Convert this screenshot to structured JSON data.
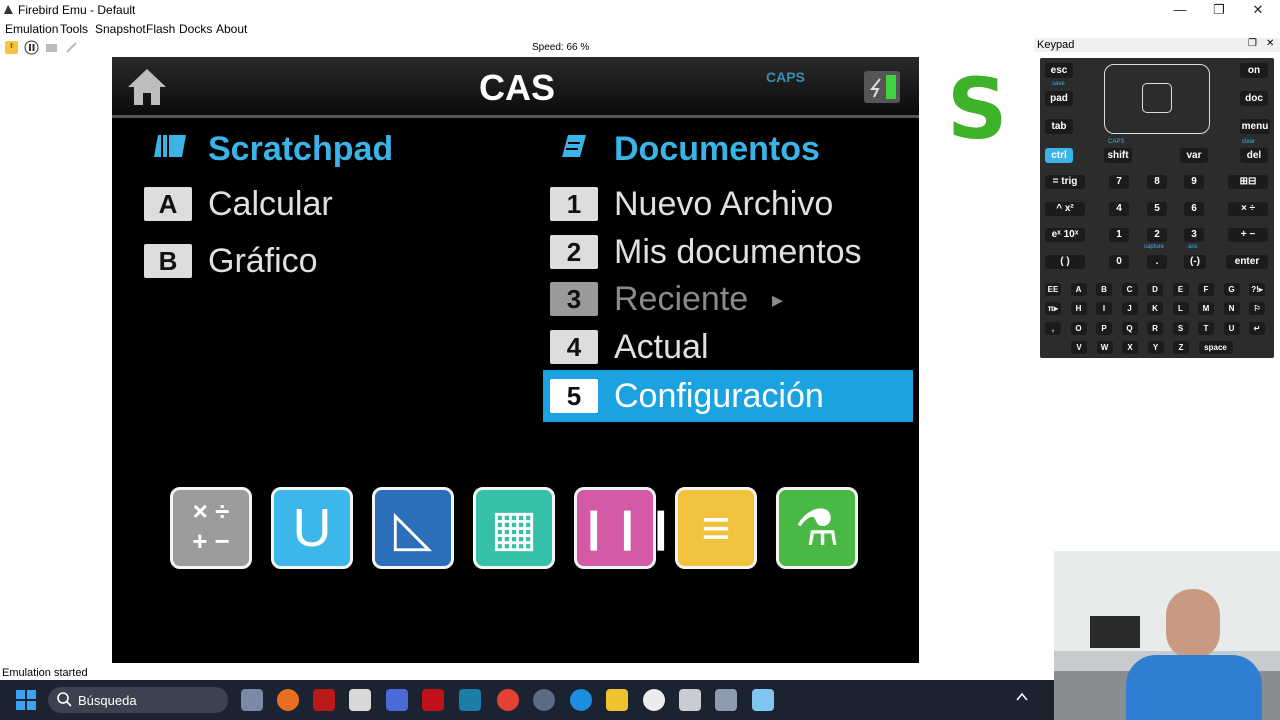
{
  "window": {
    "title": "Firebird Emu - Default",
    "minimize_glyph": "—",
    "maximize_glyph": "❐",
    "close_glyph": "✕"
  },
  "menu": [
    "Emulation",
    "Tools",
    "Snapshot",
    "Flash",
    "Docks",
    "About"
  ],
  "toolbar": {
    "speed": "Speed: 66 %"
  },
  "calc": {
    "header_title": "CAS",
    "caps": "CAPS",
    "scratchpad": {
      "title": "Scratchpad",
      "items": [
        {
          "key": "A",
          "label": "Calcular"
        },
        {
          "key": "B",
          "label": "Gráfico"
        }
      ]
    },
    "documents": {
      "title": "Documentos",
      "items": [
        {
          "key": "1",
          "label": "Nuevo Archivo"
        },
        {
          "key": "2",
          "label": "Mis documentos"
        },
        {
          "key": "3",
          "label": "Reciente"
        },
        {
          "key": "4",
          "label": "Actual"
        },
        {
          "key": "5",
          "label": "Configuración"
        }
      ]
    },
    "reciente_arrow": "▸",
    "apps": [
      "calculator-app-icon",
      "graphs-app-icon",
      "geometry-app-icon",
      "lists-spreadsheet-app-icon",
      "data-statistics-app-icon",
      "notes-app-icon",
      "vernier-dataquest-app-icon"
    ],
    "app_glyphs": {
      "calc": "× ÷\n+ −",
      "graph": "U",
      "geom": "◺",
      "lists": "▦",
      "data": "❙❙❙",
      "notes": "≡",
      "lab": "⚗"
    }
  },
  "sidebar_logo": "S",
  "keypad": {
    "title": "Keypad",
    "float_glyph": "❐",
    "close_glyph": "✕",
    "top": {
      "esc": "esc",
      "pad": "pad",
      "tab": "tab",
      "on": "on",
      "doc": "doc",
      "menu": "menu",
      "save": "save"
    },
    "row_ctrl": {
      "ctrl": "ctrl",
      "shift": "shift",
      "var": "var",
      "del": "del",
      "caps": "CAPS",
      "clear": "clear"
    },
    "num_rows": [
      [
        "= trig",
        "7",
        "8",
        "9",
        "⊞⊟"
      ],
      [
        "^  x²",
        "4",
        "5",
        "6",
        "×  ÷"
      ],
      [
        "eˣ  10ˣ",
        "1",
        "2",
        "3",
        "+  −"
      ],
      [
        "(   )",
        "0",
        ".",
        "(-)",
        "enter"
      ]
    ],
    "alpha_rows": [
      [
        "EE",
        "A",
        "B",
        "C",
        "D",
        "E",
        "F",
        "G",
        "?!▸"
      ],
      [
        "π▸",
        "H",
        "I",
        "J",
        "K",
        "L",
        "M",
        "N",
        "⚐"
      ],
      [
        ",",
        "O",
        "P",
        "Q",
        "R",
        "S",
        "T",
        "U",
        "↵"
      ],
      [
        "V",
        "W",
        "X",
        "Y",
        "Z",
        "space"
      ]
    ],
    "labels_small": {
      "capture": "capture",
      "ans": "ans"
    }
  },
  "status_bar": "Emulation started",
  "taskbar": {
    "search_placeholder": "Búsqueda"
  }
}
